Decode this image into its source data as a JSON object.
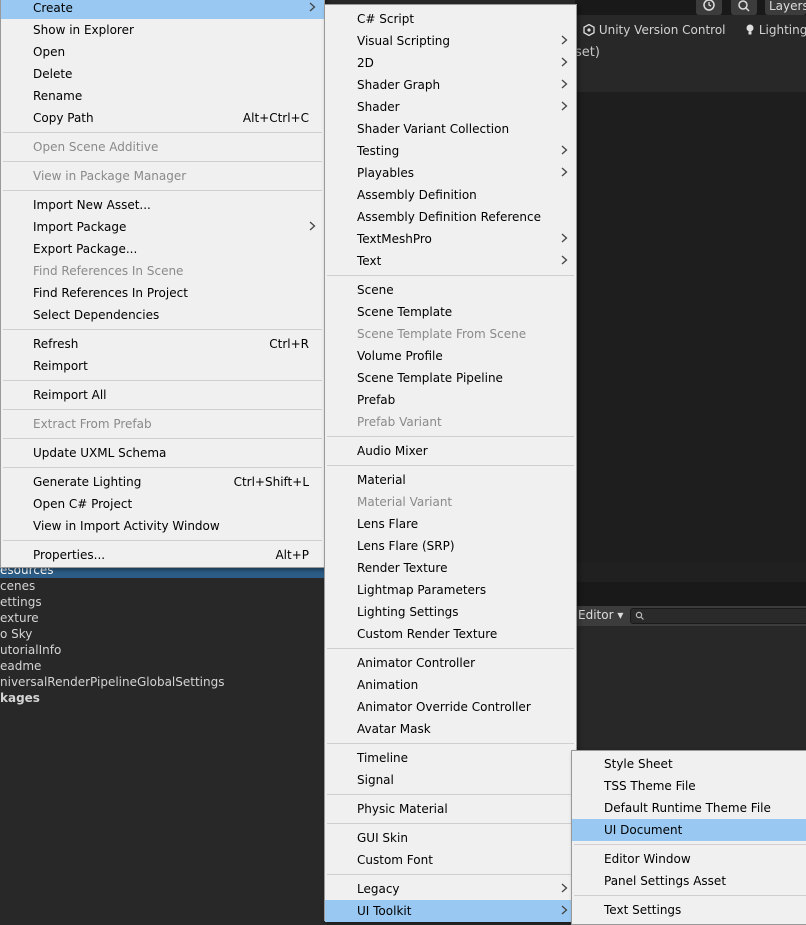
{
  "toolbar": {
    "history_icon": "history-icon",
    "search_icon": "search-icon",
    "layers_label": "Layers"
  },
  "tabs": {
    "version_control": "Unity Version Control",
    "lighting": "Lighting"
  },
  "scene_fragment": "set)",
  "bottom_toolbar": {
    "editor_label": "Editor ▾",
    "search_placeholder": ""
  },
  "project_tree": [
    {
      "label": "esources",
      "selected": true
    },
    {
      "label": "cenes"
    },
    {
      "label": "ettings"
    },
    {
      "label": "exture"
    },
    {
      "label": "o Sky"
    },
    {
      "label": "utorialInfo"
    },
    {
      "label": "eadme"
    },
    {
      "label": "niversalRenderPipelineGlobalSettings"
    },
    {
      "label": "kages",
      "bold": true
    }
  ],
  "context_menu": {
    "items": [
      {
        "label": "Create",
        "submenu": true,
        "highlighted": true
      },
      {
        "label": "Show in Explorer"
      },
      {
        "label": "Open"
      },
      {
        "label": "Delete"
      },
      {
        "label": "Rename"
      },
      {
        "label": "Copy Path",
        "shortcut": "Alt+Ctrl+C"
      },
      {
        "sep": true
      },
      {
        "label": "Open Scene Additive",
        "disabled": true
      },
      {
        "sep": true
      },
      {
        "label": "View in Package Manager",
        "disabled": true
      },
      {
        "sep": true
      },
      {
        "label": "Import New Asset..."
      },
      {
        "label": "Import Package",
        "submenu": true
      },
      {
        "label": "Export Package..."
      },
      {
        "label": "Find References In Scene",
        "disabled": true
      },
      {
        "label": "Find References In Project"
      },
      {
        "label": "Select Dependencies"
      },
      {
        "sep": true
      },
      {
        "label": "Refresh",
        "shortcut": "Ctrl+R"
      },
      {
        "label": "Reimport"
      },
      {
        "sep": true
      },
      {
        "label": "Reimport All"
      },
      {
        "sep": true
      },
      {
        "label": "Extract From Prefab",
        "disabled": true
      },
      {
        "sep": true
      },
      {
        "label": "Update UXML Schema"
      },
      {
        "sep": true
      },
      {
        "label": "Generate Lighting",
        "shortcut": "Ctrl+Shift+L"
      },
      {
        "label": "Open C# Project"
      },
      {
        "label": "View in Import Activity Window"
      },
      {
        "sep": true
      },
      {
        "label": "Properties...",
        "shortcut": "Alt+P"
      }
    ]
  },
  "create_menu": {
    "items": [
      {
        "label": "C# Script"
      },
      {
        "label": "Visual Scripting",
        "submenu": true
      },
      {
        "label": "2D",
        "submenu": true
      },
      {
        "label": "Shader Graph",
        "submenu": true
      },
      {
        "label": "Shader",
        "submenu": true
      },
      {
        "label": "Shader Variant Collection"
      },
      {
        "label": "Testing",
        "submenu": true
      },
      {
        "label": "Playables",
        "submenu": true
      },
      {
        "label": "Assembly Definition"
      },
      {
        "label": "Assembly Definition Reference"
      },
      {
        "label": "TextMeshPro",
        "submenu": true
      },
      {
        "label": "Text",
        "submenu": true
      },
      {
        "sep": true
      },
      {
        "label": "Scene"
      },
      {
        "label": "Scene Template"
      },
      {
        "label": "Scene Template From Scene",
        "disabled": true
      },
      {
        "label": "Volume Profile"
      },
      {
        "label": "Scene Template Pipeline"
      },
      {
        "label": "Prefab"
      },
      {
        "label": "Prefab Variant",
        "disabled": true
      },
      {
        "sep": true
      },
      {
        "label": "Audio Mixer"
      },
      {
        "sep": true
      },
      {
        "label": "Material"
      },
      {
        "label": "Material Variant",
        "disabled": true
      },
      {
        "label": "Lens Flare"
      },
      {
        "label": "Lens Flare (SRP)"
      },
      {
        "label": "Render Texture"
      },
      {
        "label": "Lightmap Parameters"
      },
      {
        "label": "Lighting Settings"
      },
      {
        "label": "Custom Render Texture"
      },
      {
        "sep": true
      },
      {
        "label": "Animator Controller"
      },
      {
        "label": "Animation"
      },
      {
        "label": "Animator Override Controller"
      },
      {
        "label": "Avatar Mask"
      },
      {
        "sep": true
      },
      {
        "label": "Timeline"
      },
      {
        "label": "Signal"
      },
      {
        "sep": true
      },
      {
        "label": "Physic Material"
      },
      {
        "sep": true
      },
      {
        "label": "GUI Skin"
      },
      {
        "label": "Custom Font"
      },
      {
        "sep": true
      },
      {
        "label": "Legacy",
        "submenu": true
      },
      {
        "label": "UI Toolkit",
        "submenu": true,
        "highlighted": true
      }
    ]
  },
  "uitoolkit_menu": {
    "items": [
      {
        "label": "Style Sheet"
      },
      {
        "label": "TSS Theme File"
      },
      {
        "label": "Default Runtime Theme File"
      },
      {
        "label": "UI Document",
        "highlighted": true
      },
      {
        "sep": true
      },
      {
        "label": "Editor Window"
      },
      {
        "label": "Panel Settings Asset"
      },
      {
        "sep": true
      },
      {
        "label": "Text Settings"
      }
    ]
  }
}
